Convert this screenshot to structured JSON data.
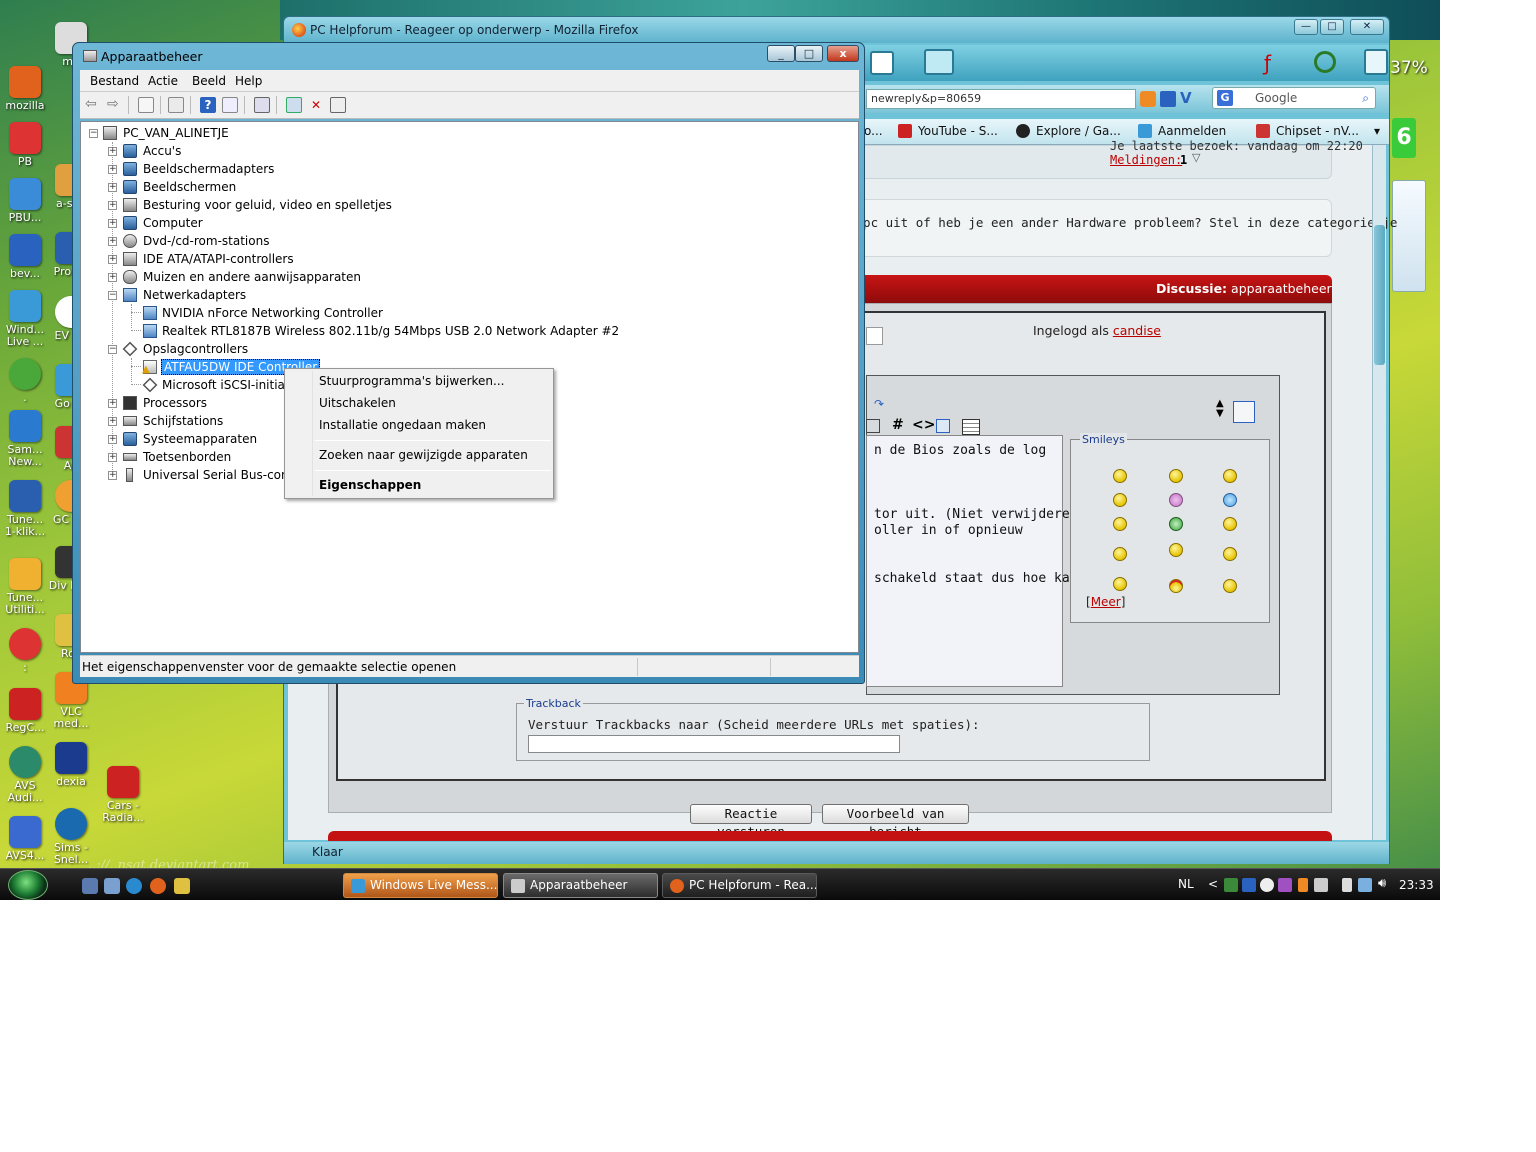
{
  "desktop": {
    "icons": [
      {
        "label": "mozilla",
        "color": "#e0621c"
      },
      {
        "label": "PB",
        "color": "#d33"
      },
      {
        "label": "PBU...",
        "color": "#3a8bd8"
      },
      {
        "label": "bev...",
        "color": "#2a62c0"
      },
      {
        "label": "Wind... Live ...",
        "color": "#3a9ad8"
      },
      {
        "label": ".",
        "color": "#4aa83a"
      },
      {
        "label": "Sam... New...",
        "color": "#2a7bd0"
      },
      {
        "label": "Tune... 1-klik...",
        "color": "#2a5fb0"
      },
      {
        "label": "Tune... Utiliti...",
        "color": "#f0b030"
      },
      {
        "label": ":",
        "color": "#d33"
      },
      {
        "label": "RegC...",
        "color": "#c22"
      },
      {
        "label": "AVS Audi...",
        "color": "#2a8a6a"
      },
      {
        "label": "AVS4...",
        "color": "#3a6ad0"
      }
    ],
    "icons_col2": [
      {
        "label": "ma",
        "color": "#ddd"
      },
      {
        "label": "a-s Fr",
        "color": "#e0a040"
      },
      {
        "label": "Pro en",
        "color": "#2a5fb0"
      },
      {
        "label": "EV Ho",
        "color": "#ffffff"
      },
      {
        "label": "Go Re",
        "color": "#3a9ad8"
      },
      {
        "label": "Au",
        "color": "#c33"
      },
      {
        "label": "GC Pla",
        "color": "#f0a030"
      },
      {
        "label": "Div Play",
        "color": "#333"
      },
      {
        "label": "Roc",
        "color": "#e0c040"
      },
      {
        "label": "VLC med...",
        "color": "#f08020"
      },
      {
        "label": "dexia",
        "color": "#1a3b8e"
      },
      {
        "label": "Sims - Snel...",
        "color": "#1a6ab0"
      },
      {
        "label": "Cars - Radia...",
        "color": "#c22"
      }
    ],
    "watermark": "..://..nsat.deviantart.com"
  },
  "firefox": {
    "title": "PC Helpforum - Reageer op onderwerp - Mozilla Firefox",
    "controls": [
      "—",
      "□",
      "✕"
    ],
    "url": "newreply&p=80659",
    "search_engine": "G",
    "search_placeholder": "Google",
    "bookmarks": [
      {
        "label": "YouTube - S...",
        "color": "#c22"
      },
      {
        "label": "Explore / Ga...",
        "color": "#222"
      },
      {
        "label": "Aanmelden",
        "color": "#3a9ad8"
      },
      {
        "label": "Chipset - nV...",
        "color": "#c33"
      }
    ],
    "bookmark_overflow": "o...",
    "status": "Klaar",
    "page": {
      "header_partial": "Je laatste bezoek: vandaag om 22:20",
      "notifications_label": "Meldingen:",
      "notifications_count": "1",
      "description": "e pc uit of heb je een ander Hardware probleem? Stel in deze categorie je",
      "discussion_label": "Discussie:",
      "discussion_title": "apparaatbeheer",
      "logged_in_label": "Ingelogd als",
      "logged_in_user": "candise",
      "message_lines": "n de Bios zoals de log\n\n\n\ntor uit. (Niet verwijderen !!)\noller in of opnieuw\n\n\nschakeld staat dus hoe kan",
      "smileys_label": "Smileys",
      "more_open": "[",
      "more_link": "Meer",
      "more_close": "]",
      "trackback_label": "Trackback",
      "trackback_text": "Verstuur Trackbacks naar (Scheid meerdere URLs met spaties):",
      "submit_button": "Reactie versturen",
      "preview_button": "Voorbeeld van bericht"
    }
  },
  "device_manager": {
    "title": "Apparaatbeheer",
    "menu": [
      "Bestand",
      "Actie",
      "Beeld",
      "Help"
    ],
    "root": "PC_VAN_ALINETJE",
    "categories": [
      "Accu's",
      "Beeldschermadapters",
      "Beeldschermen",
      "Besturing voor geluid, video en spelletjes",
      "Computer",
      "Dvd-/cd-rom-stations",
      "IDE ATA/ATAPI-controllers",
      "Muizen en andere aanwijsapparaten",
      "Netwerkadapters"
    ],
    "network_children": [
      "NVIDIA nForce Networking Controller",
      "Realtek RTL8187B Wireless 802.11b/g 54Mbps USB 2.0 Network Adapter #2"
    ],
    "storage_category": "Opslagcontrollers",
    "storage_children": [
      "ATFAU5DW IDE Controller",
      "Microsoft iSCSI-initiator"
    ],
    "categories_after": [
      "Processors",
      "Schijfstations",
      "Systeemapparaten",
      "Toetsenborden",
      "Universal Serial Bus-controllers"
    ],
    "status": "Het eigenschappenvenster voor de gemaakte selectie openen"
  },
  "context_menu": {
    "items": [
      "Stuurprogramma's bijwerken...",
      "Uitschakelen",
      "Installatie ongedaan maken",
      "Zoeken naar gewijzigde apparaten",
      "Eigenschappen"
    ]
  },
  "taskbar": {
    "tasks": [
      {
        "label": "Windows Live Mess...",
        "state": "flash"
      },
      {
        "label": "Apparaatbeheer",
        "state": "active"
      },
      {
        "label": "PC Helpforum - Rea...",
        "state": "normal"
      }
    ],
    "language": "NL",
    "tray_expand": "<",
    "clock": "23:33"
  },
  "sidebar": {
    "battery_percent": "37%",
    "green_tile": "6"
  }
}
